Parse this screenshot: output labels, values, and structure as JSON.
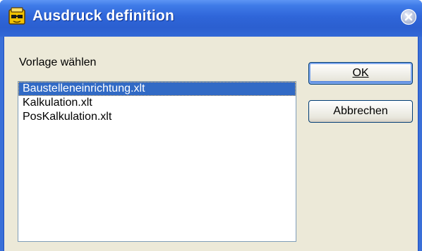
{
  "window": {
    "title": "Ausdruck definition",
    "icon": "app-icon",
    "close_icon": "close-icon",
    "accent": "#2b5fd0"
  },
  "form": {
    "label": "Vorlage wählen",
    "templates": [
      {
        "label": "Baustelleneinrichtung.xlt",
        "selected": true
      },
      {
        "label": "Kalkulation.xlt",
        "selected": false
      },
      {
        "label": "PosKalkulation.xlt",
        "selected": false
      }
    ],
    "selection_color": "#316ac5"
  },
  "buttons": {
    "ok_label": "OK",
    "cancel_label": "Abbrechen"
  }
}
